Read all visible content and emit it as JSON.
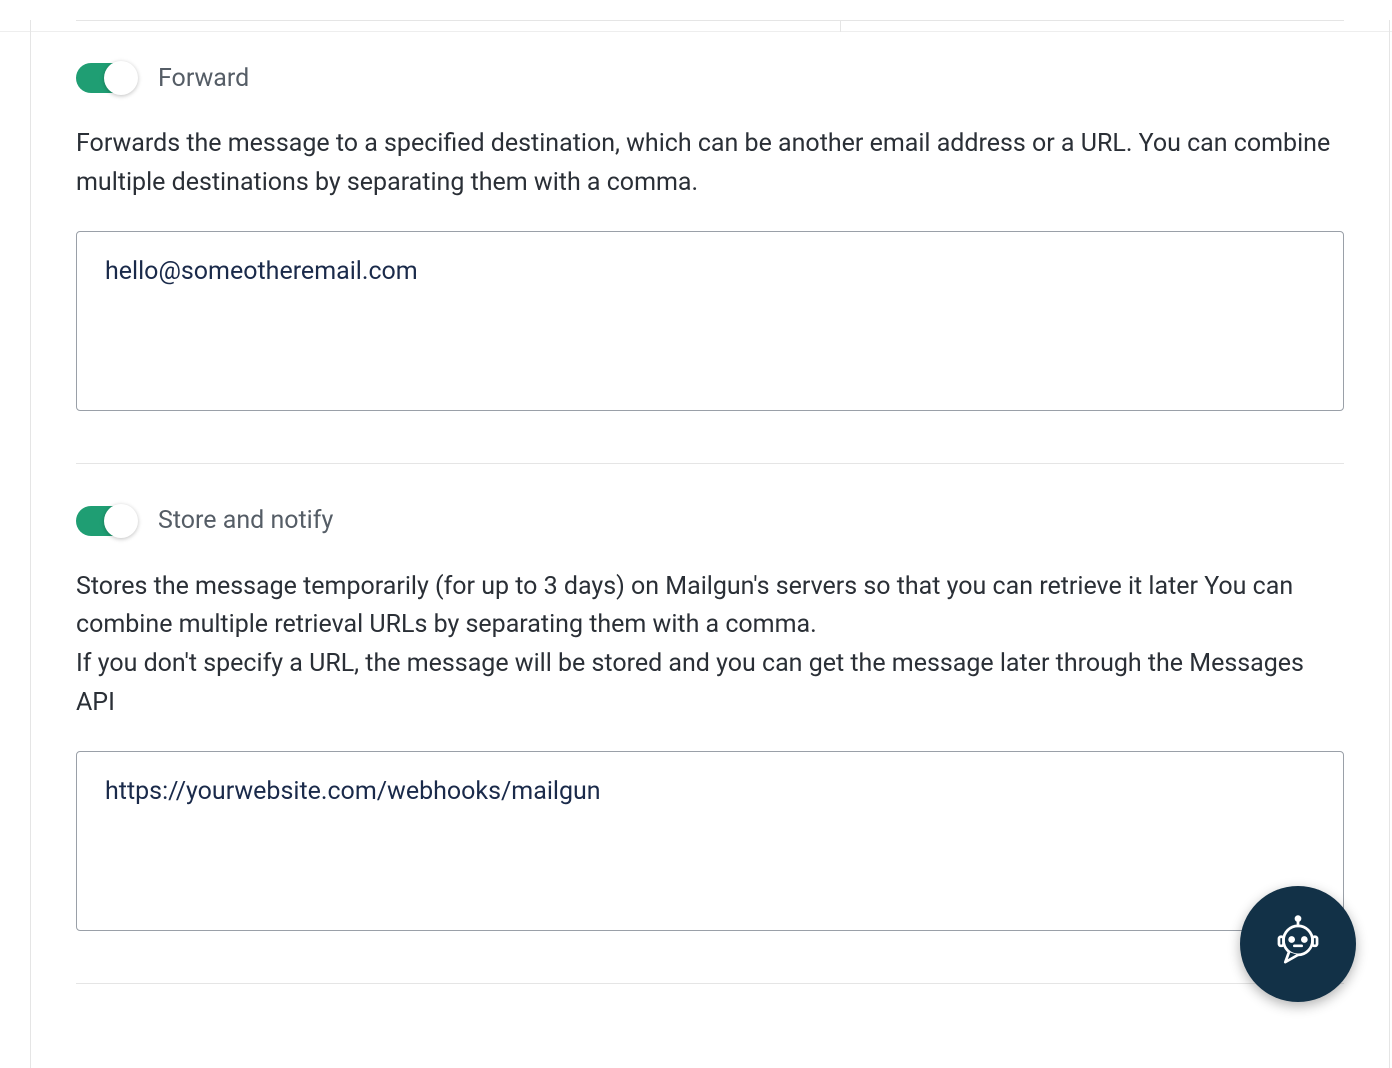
{
  "sections": {
    "forward": {
      "label": "Forward",
      "description": "Forwards the message to a specified destination, which can be another email address or a URL. You can combine multiple destinations by separating them with a comma.",
      "value": "hello@someotheremail.com",
      "enabled": true
    },
    "store": {
      "label": "Store and notify",
      "description": "Stores the message temporarily (for up to 3 days) on Mailgun's servers so that you can retrieve it later You can combine multiple retrieval URLs by separating them with a comma.\nIf you don't specify a URL, the message will be stored and you can get the message later through the Messages API",
      "value": "https://yourwebsite.com/webhooks/mailgun",
      "enabled": true
    }
  }
}
